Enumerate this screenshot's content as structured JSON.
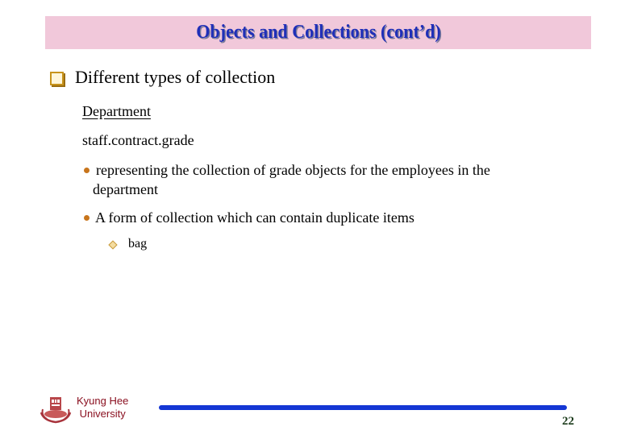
{
  "slide": {
    "title": "Objects and Collections (cont’d)",
    "bullet_l1": "Different types of collection",
    "department": "Department",
    "path": "staff.contract.grade",
    "bullets_l2": [
      {
        "line1": "representing the collection of grade objects for the employees in the",
        "line2": "department"
      },
      {
        "line1": "A form of collection which can contain duplicate items"
      }
    ],
    "bullet_l3": "bag",
    "footer": {
      "university_line1": "Kyung Hee",
      "university_line2": "University",
      "page_number": "22"
    }
  },
  "colors": {
    "title_bg": "#f1c8da",
    "title_text": "#1f2fb8",
    "footer_bar": "#1436d4",
    "university_text": "#8a1020"
  }
}
